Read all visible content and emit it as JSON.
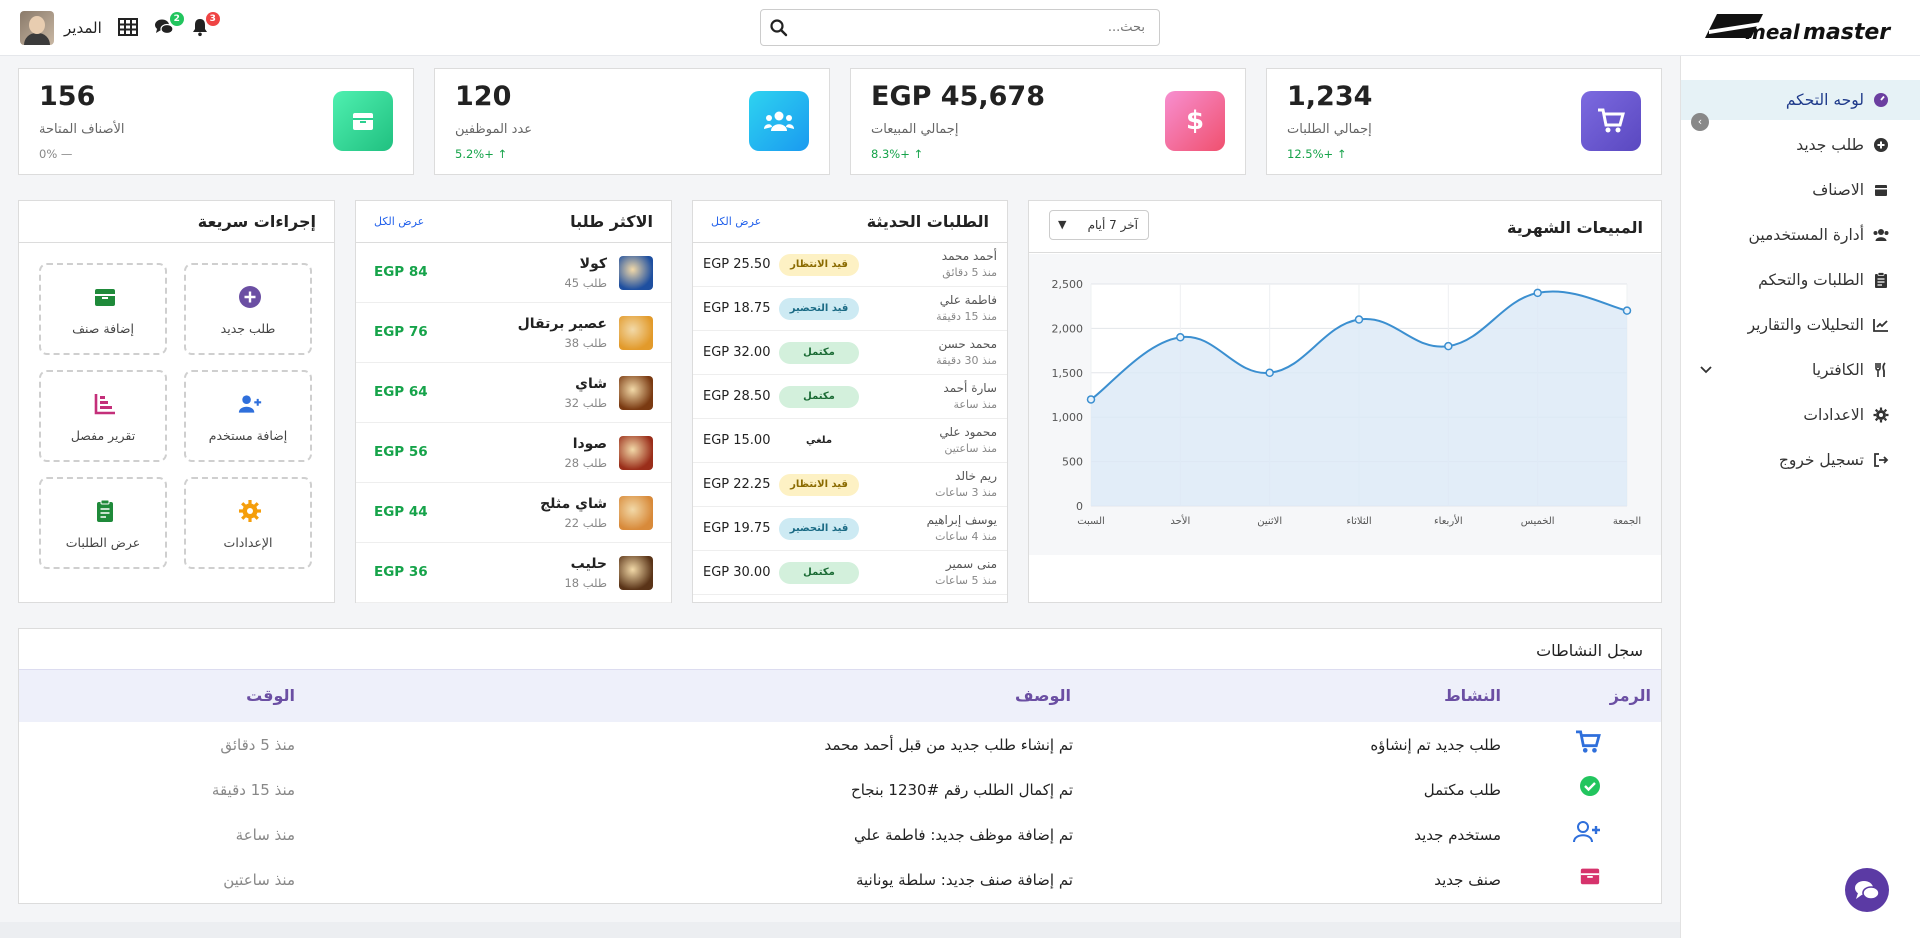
{
  "app": {
    "brand": "Meal Master"
  },
  "search": {
    "placeholder": "بحث..."
  },
  "header": {
    "admin_name": "المدير",
    "messages_badge": "2",
    "notifications_badge": "3"
  },
  "sidebar": {
    "items": [
      {
        "label": "لوحه التحكم",
        "icon": "dashboard-gauge-icon"
      },
      {
        "label": "طلب جديد",
        "icon": "plus-circle-icon"
      },
      {
        "label": "الاصناف",
        "icon": "box-icon"
      },
      {
        "label": "أدارة المستخدمين",
        "icon": "users-icon"
      },
      {
        "label": "الطلبات والتحكم",
        "icon": "clipboard-icon"
      },
      {
        "label": "التحليلات والتقارير",
        "icon": "chart-line-icon"
      },
      {
        "label": "الكافتريا",
        "icon": "utensils-icon"
      },
      {
        "label": "الاعدادات",
        "icon": "gear-icon"
      },
      {
        "label": "تسجيل خروج",
        "icon": "logout-icon"
      }
    ]
  },
  "stats": [
    {
      "value": "1,234",
      "label": "إجمالي الطلبات",
      "change": "12.5%+",
      "icon": "cart-icon",
      "color": "#6d5bd0"
    },
    {
      "value": "EGP 45,678",
      "label": "إجمالي المبيعات",
      "change": "8.3%+",
      "icon": "dollar-icon",
      "color": "#f0609a"
    },
    {
      "value": "120",
      "label": "عدد الموظفين",
      "change": "5.2%+",
      "icon": "users-icon",
      "color": "#22a7f0"
    },
    {
      "value": "156",
      "label": "الأصناف المتاحة",
      "change": "0%",
      "icon": "box-icon",
      "color": "#34d399"
    }
  ],
  "monthly_sales": {
    "title": "المبيعات الشهرية",
    "range_select": "آخر 7 أيام"
  },
  "chart_data": {
    "type": "area",
    "categories": [
      "السبت",
      "الأحد",
      "الاثنين",
      "الثلاثاء",
      "الأربعاء",
      "الخميس",
      "الجمعة"
    ],
    "values": [
      1200,
      1900,
      1500,
      2100,
      1800,
      2400,
      2200
    ],
    "ylim": [
      0,
      2500
    ],
    "yticks": [
      "0",
      "500",
      "1,000",
      "1,500",
      "2,000",
      "2,500"
    ],
    "grid": true,
    "line_color": "#3b8fd0",
    "fill_color": "#dbe9f6"
  },
  "recent_orders": {
    "title": "الطلبات الحديثة",
    "view_all": "عرض الكل",
    "rows": [
      {
        "name": "أحمد محمد",
        "time": "منذ 5 دقائق",
        "status": "قيد الانتظار",
        "status_type": "pending",
        "amount": "EGP 25.50"
      },
      {
        "name": "فاطمة علي",
        "time": "منذ 15 دقيقة",
        "status": "قيد التحضير",
        "status_type": "preparing",
        "amount": "EGP 18.75"
      },
      {
        "name": "محمد حسن",
        "time": "منذ 30 دقيقة",
        "status": "مكتمل",
        "status_type": "done",
        "amount": "EGP 32.00"
      },
      {
        "name": "سارة أحمد",
        "time": "منذ ساعة",
        "status": "مكتمل",
        "status_type": "done",
        "amount": "EGP 28.50"
      },
      {
        "name": "محمود علي",
        "time": "منذ ساعتين",
        "status": "ملغي",
        "status_type": "cancelled",
        "amount": "EGP 15.00"
      },
      {
        "name": "ريم خالد",
        "time": "منذ 3 ساعات",
        "status": "قيد الانتظار",
        "status_type": "pending",
        "amount": "EGP 22.25"
      },
      {
        "name": "يوسف إبراهيم",
        "time": "منذ 4 ساعات",
        "status": "قيد التحضير",
        "status_type": "preparing",
        "amount": "EGP 19.75"
      },
      {
        "name": "منى سمير",
        "time": "منذ 5 ساعات",
        "status": "مكتمل",
        "status_type": "done",
        "amount": "EGP 30.00"
      }
    ]
  },
  "top_items": {
    "title": "الاكثر طلبا",
    "view_all": "عرض الكل",
    "rows": [
      {
        "name": "كولا",
        "count": "45 طلب",
        "price": "EGP 84",
        "color": "#1e4fa0"
      },
      {
        "name": "عصير برتقال",
        "count": "38 طلب",
        "price": "EGP 76",
        "color": "#e29a2b"
      },
      {
        "name": "شاي",
        "count": "32 طلب",
        "price": "EGP 64",
        "color": "#7a3a12"
      },
      {
        "name": "صودا",
        "count": "28 طلب",
        "price": "EGP 56",
        "color": "#9a2e1a"
      },
      {
        "name": "شاي مثلج",
        "count": "22 طلب",
        "price": "EGP 44",
        "color": "#d88a3a"
      },
      {
        "name": "حليب",
        "count": "18 طلب",
        "price": "EGP 36",
        "color": "#5a3418"
      }
    ]
  },
  "quick_actions": {
    "title": "إجراءات سريعة",
    "items": [
      {
        "label": "طلب جديد",
        "icon": "plus-circle-icon",
        "color": "#6b4fa3"
      },
      {
        "label": "إضافة صنف",
        "icon": "box-icon",
        "color": "#1f8a3a"
      },
      {
        "label": "إضافة مستخدم",
        "icon": "user-plus-icon",
        "color": "#2f6fdb"
      },
      {
        "label": "تقرير مفصل",
        "icon": "chart-bar-icon",
        "color": "#c42f7a"
      },
      {
        "label": "الإعدادات",
        "icon": "gear-icon",
        "color": "#f59e0b"
      },
      {
        "label": "عرض الطلبات",
        "icon": "clipboard-icon",
        "color": "#1f8a3a"
      }
    ]
  },
  "activity": {
    "title": "سجل النشاطات",
    "headers": {
      "icon": "الرمز",
      "activity": "النشاط",
      "description": "الوصف",
      "time": "الوقت"
    },
    "rows": [
      {
        "activity": "طلب جديد تم إنشاؤه",
        "description": "تم إنشاء طلب جديد من قبل أحمد محمد",
        "time": "منذ 5 دقائق",
        "icon": "cart-icon",
        "color": "#2f6fdb"
      },
      {
        "activity": "طلب مكتمل",
        "description": "تم إكمال الطلب رقم #1230 بنجاح",
        "time": "منذ 15 دقيقة",
        "icon": "check-circle-icon",
        "color": "#22c55e"
      },
      {
        "activity": "مستخدم جديد",
        "description": "تم إضافة موظف جديد: فاطمة علي",
        "time": "منذ ساعة",
        "icon": "user-plus-icon",
        "color": "#2f6fdb"
      },
      {
        "activity": "صنف جديد",
        "description": "تم إضافة صنف جديد: سلطة يونانية",
        "time": "منذ ساعتين",
        "icon": "box-icon",
        "color": "#d6336c"
      }
    ]
  }
}
